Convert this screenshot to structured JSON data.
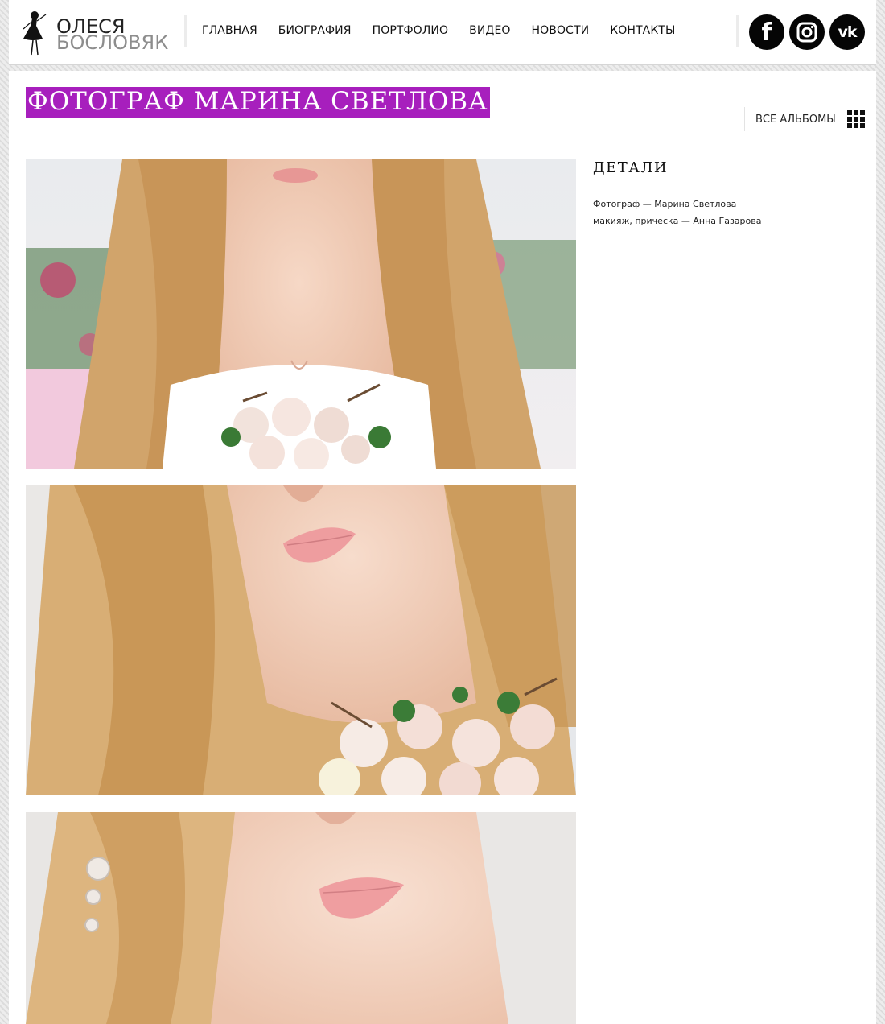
{
  "logo": {
    "first_name": "ОЛЕСЯ",
    "last_name": "БОСЛОВЯК"
  },
  "nav": {
    "items": [
      "ГЛАВНАЯ",
      "БИОГРАФИЯ",
      "ПОРТФОЛИО",
      "ВИДЕО",
      "НОВОСТИ",
      "КОНТАКТЫ"
    ]
  },
  "social": {
    "facebook": {
      "label": "f",
      "icon": "facebook-icon"
    },
    "instagram": {
      "icon": "instagram-icon"
    },
    "vk": {
      "label": "vk",
      "icon": "vk-icon"
    }
  },
  "page": {
    "title": "ФОТОГРАФ МАРИНА СВЕТЛОВА",
    "title_bg": "#a71fbd",
    "all_albums": "ВСЕ АЛЬБОМЫ",
    "all_albums_icon": "grid-icon"
  },
  "details": {
    "title": "ДЕТАЛИ",
    "lines": [
      "Фотограф — Марина Светлова",
      "макияж, прическа — Анна Газарова"
    ]
  },
  "photos": [
    {
      "subject": "bride-photo-1"
    },
    {
      "subject": "bride-photo-2"
    },
    {
      "subject": "bride-photo-3"
    }
  ]
}
